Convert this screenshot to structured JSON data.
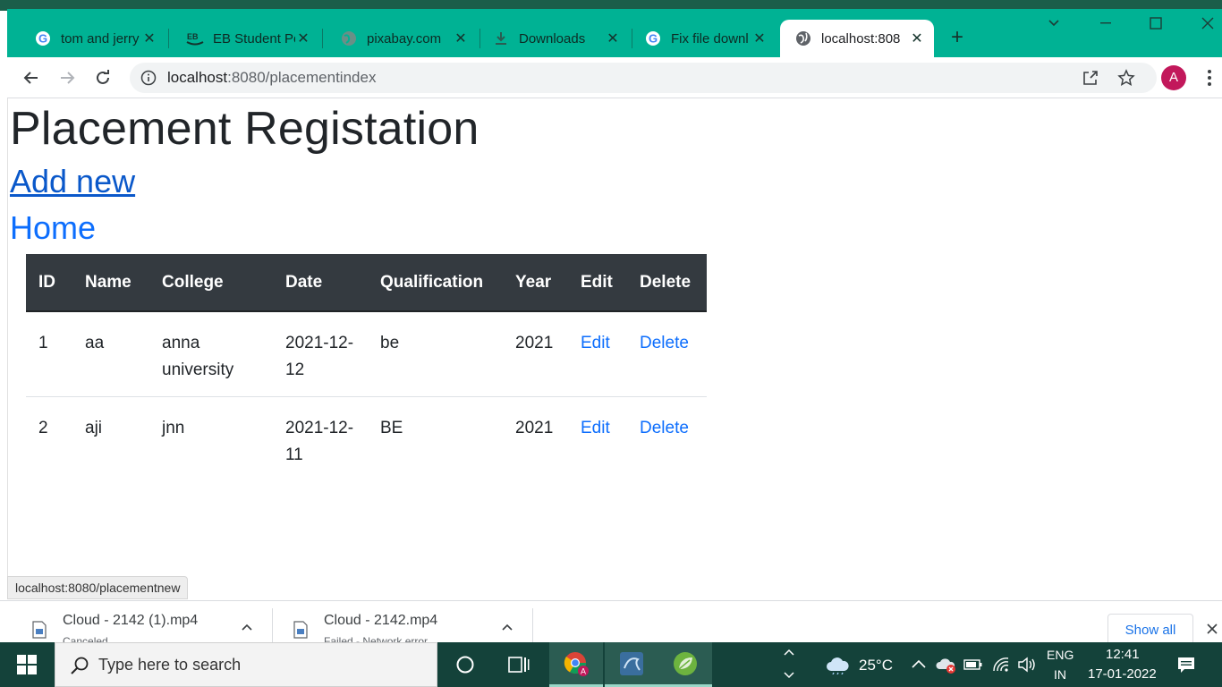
{
  "browser": {
    "tabs": [
      {
        "label": "tom and jerry",
        "icon": "google-g-icon"
      },
      {
        "label": "EB Student Po",
        "icon": "eb-logo-icon"
      },
      {
        "label": "pixabay.com",
        "icon": "globe-icon"
      },
      {
        "label": "Downloads",
        "icon": "download-icon"
      },
      {
        "label": "Fix file downl",
        "icon": "google-g-icon"
      },
      {
        "label": "localhost:808",
        "icon": "globe-icon",
        "active": true
      }
    ],
    "url_host": "localhost",
    "url_path": ":8080/placementindex",
    "profile_initial": "A"
  },
  "page": {
    "title": "Placement Registation",
    "add_new": "Add new",
    "home": "Home",
    "table": {
      "headers": [
        "ID",
        "Name",
        "College",
        "Date",
        "Qualification",
        "Year",
        "Edit",
        "Delete"
      ],
      "rows": [
        {
          "id": "1",
          "name": "aa",
          "college": "anna university",
          "date": "2021-12-12",
          "qualification": "be",
          "year": "2021",
          "edit": "Edit",
          "delete": "Delete"
        },
        {
          "id": "2",
          "name": "aji",
          "college": "jnn",
          "date": "2021-12-11",
          "qualification": "BE",
          "year": "2021",
          "edit": "Edit",
          "delete": "Delete"
        }
      ]
    }
  },
  "status_url": "localhost:8080/placementnew",
  "downloads": {
    "items": [
      {
        "name": "Cloud - 2142 (1).mp4",
        "status": "Canceled"
      },
      {
        "name": "Cloud - 2142.mp4",
        "status": "Failed - Network error"
      }
    ],
    "show_all": "Show all"
  },
  "taskbar": {
    "search_placeholder": "Type here to search",
    "weather": "25°C",
    "lang_top": "ENG",
    "lang_bottom": "IN",
    "time": "12:41",
    "date": "17-01-2022"
  },
  "colors": {
    "tabstrip": "#00b294",
    "taskbar": "#14423a",
    "link": "#0d6efd",
    "table_header": "#343a40"
  }
}
